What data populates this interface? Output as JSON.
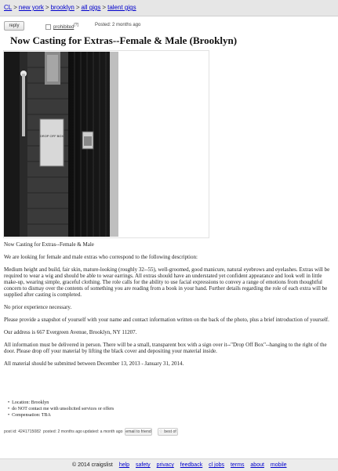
{
  "breadcrumb": {
    "items": [
      "CL",
      "new york",
      "brooklyn",
      "all gigs",
      "talent gigs"
    ],
    "separator": ">"
  },
  "actions": {
    "reply_label": "reply",
    "prohibited_label": "prohibited",
    "prohibited_mark": "[?]",
    "posted": "Posted: 2 months ago"
  },
  "title": "Now Casting for Extras--Female & Male (Brooklyn)",
  "image": {
    "sign_text": "DROP OFF BOX"
  },
  "body": {
    "paragraphs": [
      "Now Casting for Extras--Female & Male",
      "We are looking for female and male extras who correspond to the following description:",
      "Medium height and build, fair skin, mature-looking (roughly 32--55), well-groomed, good manicure, natural eyebrows and eyelashes. Extras will be required to wear a wig and should be able to wear earrings. All extras should have an understated yet confident appearance and look well in little make-up, wearing simple, graceful clothing. The role calls for the ability to use facial expressions to convey a range of emotions from thoughtful concern to dismay over the contents of something you are reading from a book in your hand. Further details regarding the role of each extra will be supplied after casting is completed.",
      "No prior experience necessary.",
      "Please provide a snapshot of yourself with your name and contact information written on the back of the photo, plus a brief introduction of yourself.",
      "Our address is 667 Evergreen Avenue, Brooklyn, NY 11207.",
      "All information must be delivered in person. There will be a small, transparent box with a sign over it--\"Drop Off Box\"--hanging to the right of the door. Please drop off your material by lifting the black cover and depositing your material inside.",
      "All material should be submitted between December 13, 2013 - January 31, 2014."
    ]
  },
  "attributes": [
    "Location: Brooklyn",
    "do NOT contact me with unsolicited services or offers",
    "Compensation: TBA"
  ],
  "post_info": {
    "post_id": "post id: 4241715082",
    "posted": "posted: 2 months ago",
    "updated": "updated: a month ago",
    "email_label": "email to friend",
    "best_of_label": "best of"
  },
  "footer": {
    "copyright": "© 2014 craigslist",
    "links": [
      "help",
      "safety",
      "privacy",
      "feedback",
      "cl jobs",
      "terms",
      "about",
      "mobile"
    ]
  }
}
